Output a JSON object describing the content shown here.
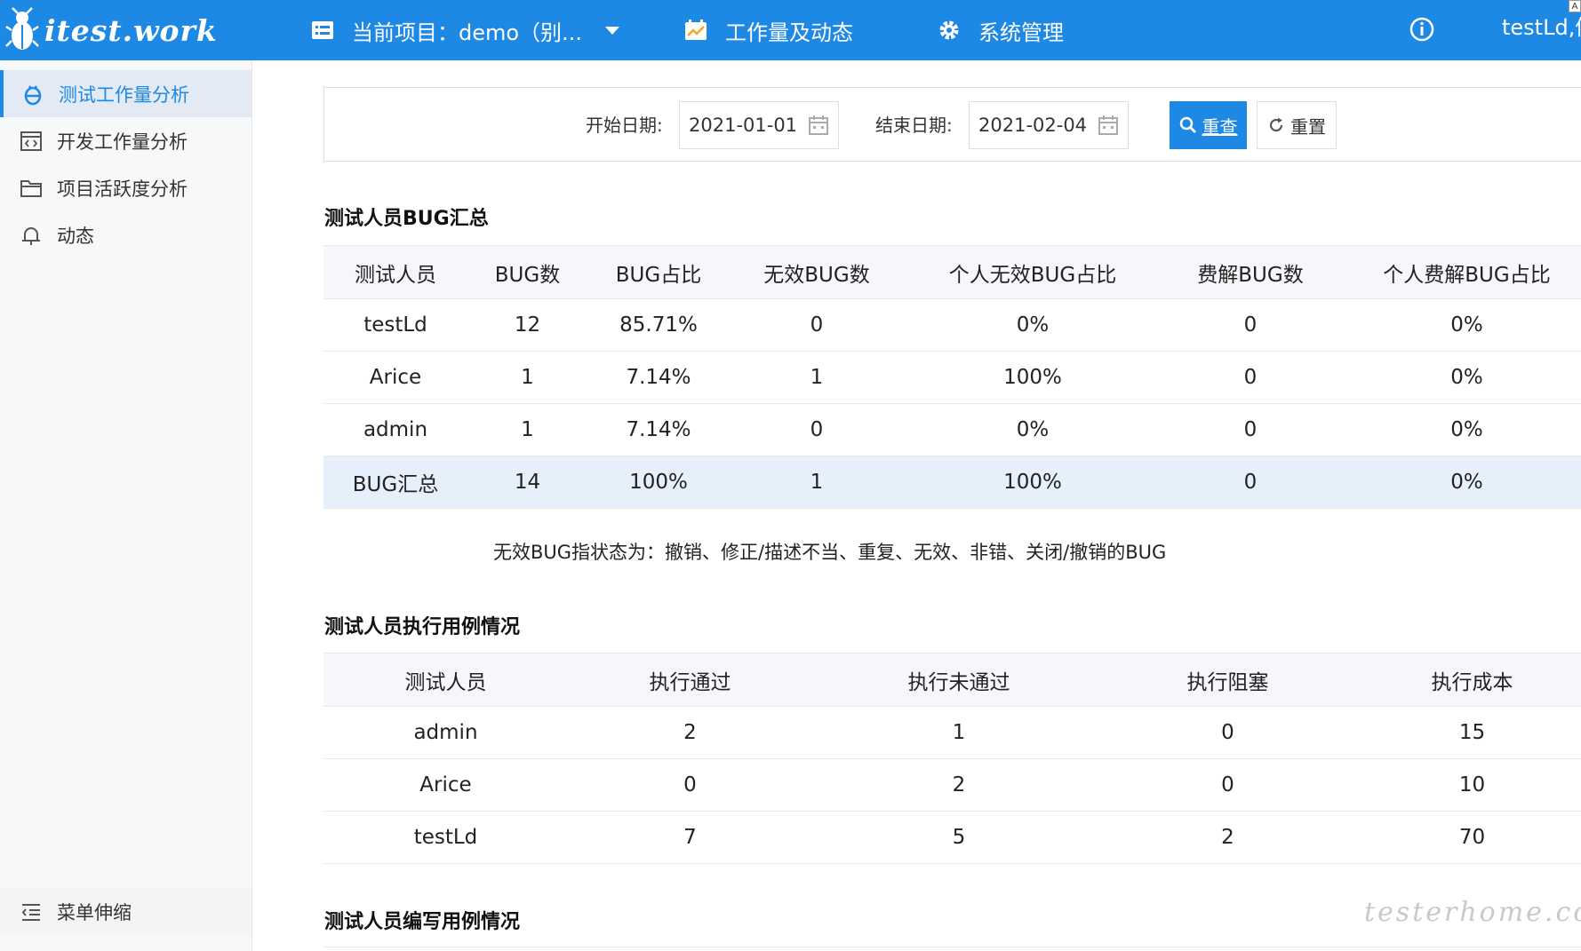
{
  "header": {
    "logo_text": "itest.work",
    "project_label": "当前项目：demo（别...",
    "workload_label": "工作量及动态",
    "system_label": "系统管理",
    "user_name": "testLd,侬",
    "corner_mark": "A"
  },
  "sidebar": {
    "items": [
      {
        "label": "测试工作量分析",
        "icon": "bug-icon",
        "active": true
      },
      {
        "label": "开发工作量分析",
        "icon": "code-window-icon",
        "active": false
      },
      {
        "label": "项目活跃度分析",
        "icon": "folder-icon",
        "active": false
      },
      {
        "label": "动态",
        "icon": "bell-icon",
        "active": false
      }
    ],
    "toggle_label": "菜单伸缩"
  },
  "filter": {
    "start_label": "开始日期:",
    "start_value": "2021-01-01",
    "end_label": "结束日期:",
    "end_value": "2021-02-04",
    "query_label": "重查",
    "reset_label": "重置"
  },
  "bug_summary": {
    "title": "测试人员BUG汇总",
    "columns": [
      "测试人员",
      "BUG数",
      "BUG占比",
      "无效BUG数",
      "个人无效BUG占比",
      "费解BUG数",
      "个人费解BUG占比"
    ],
    "rows": [
      [
        "testLd",
        "12",
        "85.71%",
        "0",
        "0%",
        "0",
        "0%"
      ],
      [
        "Arice",
        "1",
        "7.14%",
        "1",
        "100%",
        "0",
        "0%"
      ],
      [
        "admin",
        "1",
        "7.14%",
        "0",
        "0%",
        "0",
        "0%"
      ],
      [
        "BUG汇总",
        "14",
        "100%",
        "1",
        "100%",
        "0",
        "0%"
      ]
    ],
    "note": "无效BUG指状态为：撤销、修正/描述不当、重复、无效、非错、关闭/撤销的BUG"
  },
  "exec_summary": {
    "title": "测试人员执行用例情况",
    "columns": [
      "测试人员",
      "执行通过",
      "执行未通过",
      "执行阻塞",
      "执行成本"
    ],
    "rows": [
      [
        "admin",
        "2",
        "1",
        "0",
        "15"
      ],
      [
        "Arice",
        "0",
        "2",
        "0",
        "10"
      ],
      [
        "testLd",
        "7",
        "5",
        "2",
        "70"
      ]
    ]
  },
  "write_summary": {
    "title": "测试人员编写用例情况"
  },
  "watermark": "testerhome.com",
  "colors": {
    "primary": "#1e88e5",
    "sidebar_bg": "#f7f8fa",
    "active_bg": "#e3eaf4",
    "total_row_bg": "#e6f0fb"
  }
}
